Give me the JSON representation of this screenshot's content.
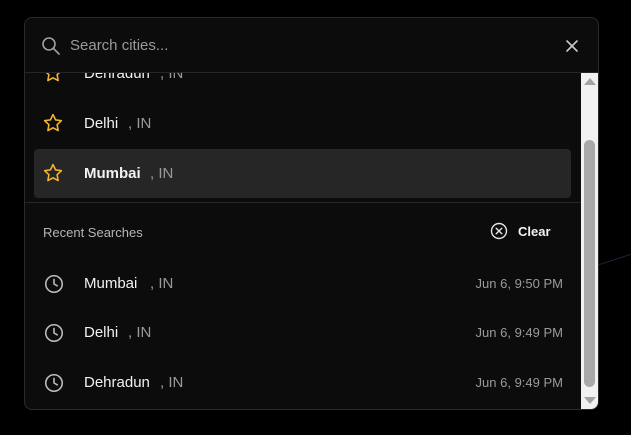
{
  "search": {
    "placeholder": "Search cities...",
    "value": ""
  },
  "favorites": [
    {
      "name": "Dehradun",
      "country": ", IN",
      "starred": false,
      "selected": false
    },
    {
      "name": "Delhi",
      "country": ", IN",
      "starred": false,
      "selected": false
    },
    {
      "name": "Mumbai",
      "country": ", IN",
      "starred": false,
      "selected": true
    }
  ],
  "recent": {
    "heading": "Recent Searches",
    "clear_label": "Clear",
    "items": [
      {
        "name": "Mumbai",
        "country": ", IN",
        "time": "Jun 6, 9:50 PM"
      },
      {
        "name": "Delhi",
        "country": ", IN",
        "time": "Jun 6, 9:49 PM"
      },
      {
        "name": "Dehradun",
        "country": ", IN",
        "time": "Jun 6, 9:49 PM"
      }
    ]
  },
  "colors": {
    "panel_background": "#0c0c0c",
    "selected_row": "#262626",
    "star_accent": "#f2b632",
    "text_primary": "#f2f2f2",
    "text_secondary": "#9a9a9a"
  },
  "icons": {
    "search": "search-icon",
    "close": "close-icon",
    "favorite": "star-outline-icon",
    "recent": "clock-icon",
    "clear": "circle-x-icon"
  }
}
